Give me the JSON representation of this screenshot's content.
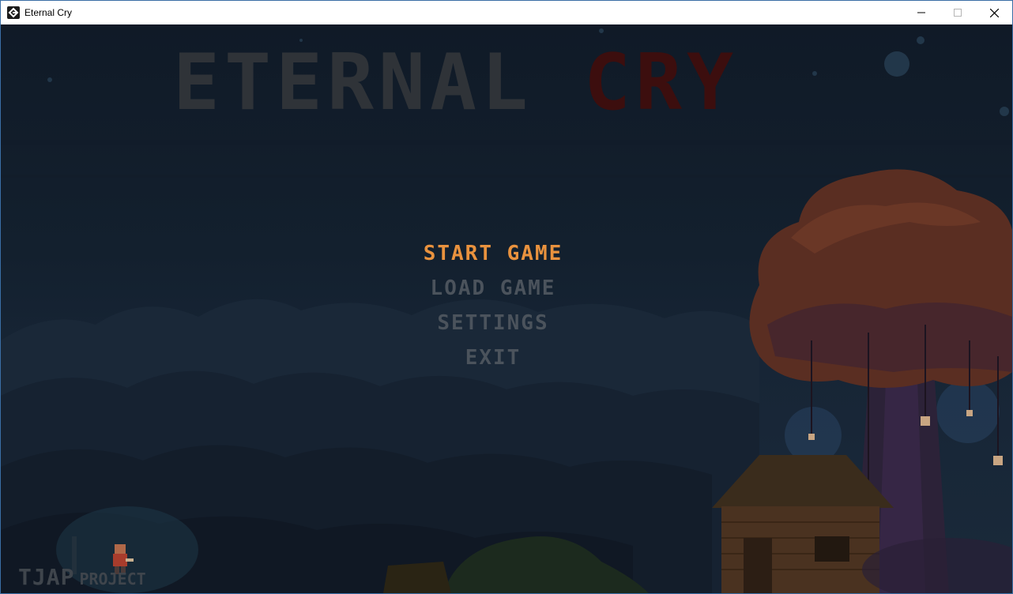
{
  "window": {
    "title": "Eternal Cry",
    "app_icon": "gamemaker-icon",
    "controls": [
      "minimize-icon",
      "maximize-icon",
      "close-icon"
    ]
  },
  "logo": {
    "word1": "ETERNAL",
    "word2": "CRY",
    "word1_color": "#2f3338",
    "word2_color": "#3c0e0e"
  },
  "menu": {
    "items": [
      {
        "label": "START GAME",
        "selected": true
      },
      {
        "label": "LOAD GAME",
        "selected": false
      },
      {
        "label": "SETTINGS",
        "selected": false
      },
      {
        "label": "EXIT",
        "selected": false
      }
    ],
    "selected_color": "#e9923e",
    "normal_color": "#4b535c"
  },
  "credit": {
    "brand": "TJAP",
    "suffix": "PROJECT"
  }
}
